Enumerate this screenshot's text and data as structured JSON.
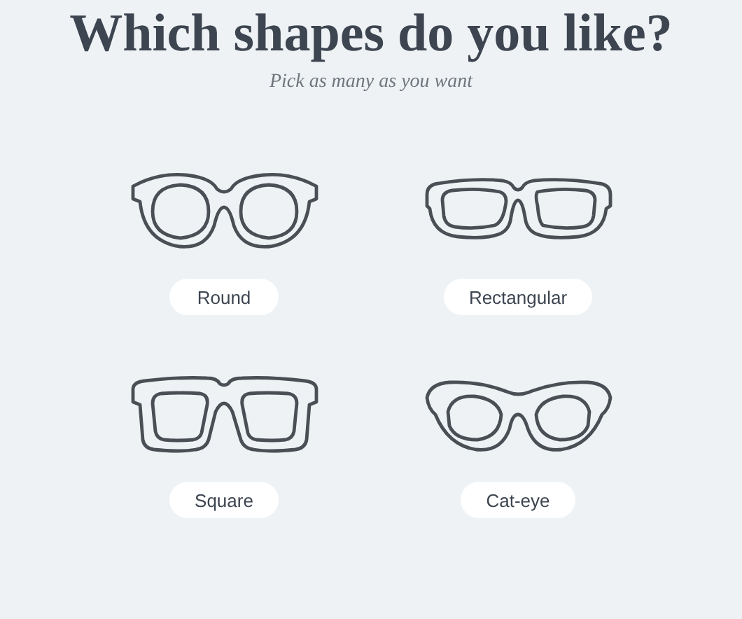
{
  "title": "Which shapes do you like?",
  "subtitle": "Pick as many as you want",
  "shapes": [
    {
      "kind": "round",
      "label": "Round",
      "selected": false
    },
    {
      "kind": "rectangular",
      "label": "Rectangular",
      "selected": false
    },
    {
      "kind": "square",
      "label": "Square",
      "selected": false
    },
    {
      "kind": "cateye",
      "label": "Cat-eye",
      "selected": false
    }
  ]
}
